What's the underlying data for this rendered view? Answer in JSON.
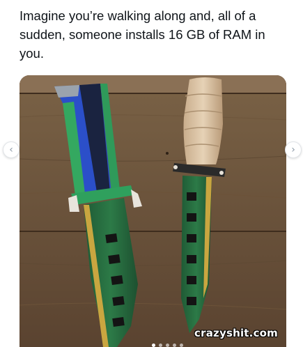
{
  "post": {
    "text": "Imagine you’re walking along and, all of a sudden, someone installs 16 GB of RAM in you."
  },
  "media": {
    "watermark": "crazyshit.com",
    "carousel": {
      "prev_icon": "chevron-left-icon",
      "next_icon": "chevron-right-icon",
      "prev_glyph": "‹",
      "next_glyph": "›",
      "slide_count": 5,
      "active_slide": 1
    }
  },
  "colors": {
    "text": "#0f1419",
    "wood": "#6a5238"
  }
}
